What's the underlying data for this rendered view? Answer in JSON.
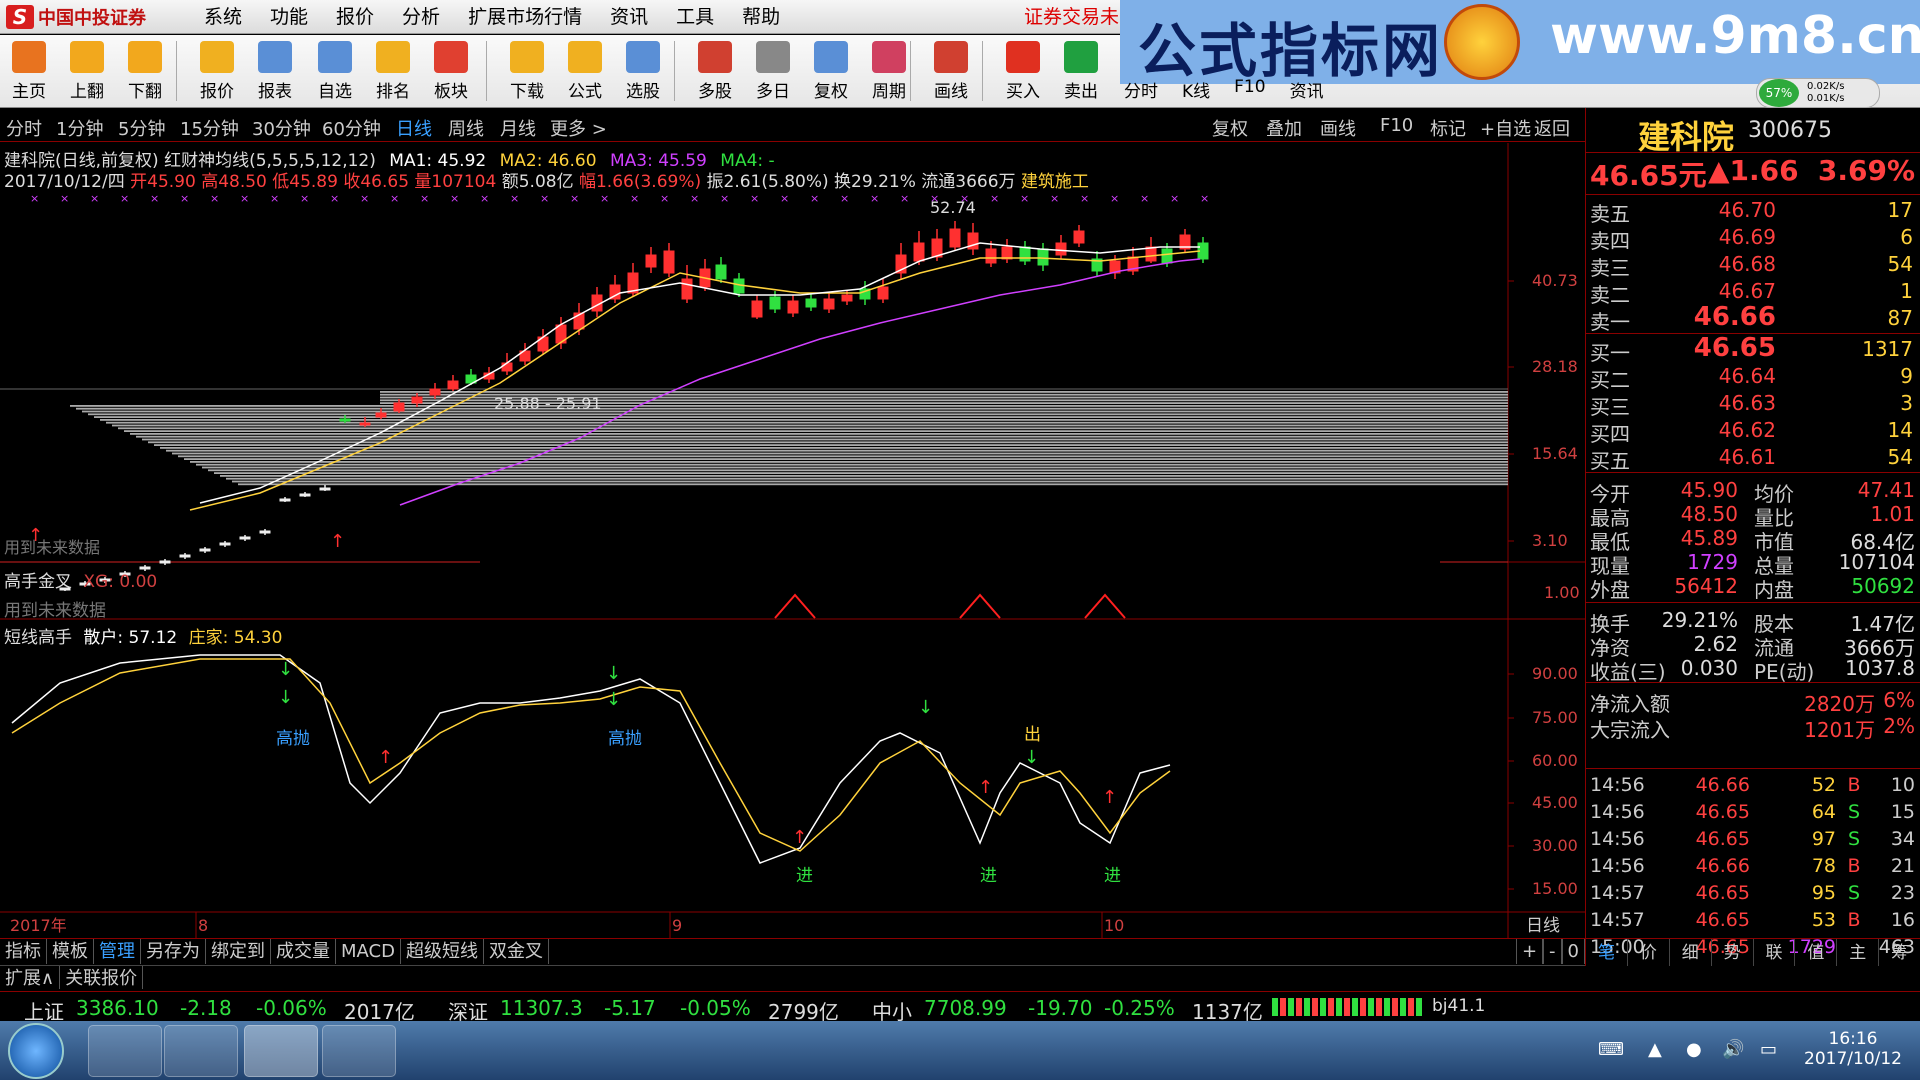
{
  "app": {
    "logo_text": "中国中投证券",
    "logo_mark": "S"
  },
  "menu": [
    "系统",
    "功能",
    "报价",
    "分析",
    "扩展市场行情",
    "资讯",
    "工具",
    "帮助"
  ],
  "menu_warning": "证券交易未",
  "toolbar": [
    {
      "label": "主页",
      "icon": "home-icon",
      "color": "#e8731f"
    },
    {
      "label": "上翻",
      "icon": "up-arrow-icon",
      "color": "#f2a81d"
    },
    {
      "label": "下翻",
      "icon": "down-arrow-icon",
      "color": "#f2a81d"
    },
    {
      "label": "报价",
      "icon": "yen-icon",
      "color": "#f0b020"
    },
    {
      "label": "报表",
      "icon": "report-icon",
      "color": "#5a8fd6"
    },
    {
      "label": "自选",
      "icon": "f6-icon",
      "color": "#5a8fd6"
    },
    {
      "label": "排名",
      "icon": "ranking-icon",
      "color": "#f0b020"
    },
    {
      "label": "板块",
      "icon": "blocks-icon",
      "color": "#e04030"
    },
    {
      "label": "下载",
      "icon": "download-icon",
      "color": "#f0b020"
    },
    {
      "label": "公式",
      "icon": "formula-icon",
      "color": "#f0b020"
    },
    {
      "label": "选股",
      "icon": "stock-pick-icon",
      "color": "#5a8fd6"
    },
    {
      "label": "多股",
      "icon": "multi-stock-icon",
      "color": "#d04030"
    },
    {
      "label": "多日",
      "icon": "clock-icon",
      "color": "#888888"
    },
    {
      "label": "复权",
      "icon": "restore-icon",
      "color": "#5a8fd6"
    },
    {
      "label": "周期",
      "icon": "f8-icon",
      "color": "#d04060"
    },
    {
      "label": "画线",
      "icon": "draw-line-icon",
      "color": "#d04030"
    },
    {
      "label": "买入",
      "icon": "buy-icon",
      "color": "#e03020"
    },
    {
      "label": "卖出",
      "icon": "sell-icon",
      "color": "#20a040"
    }
  ],
  "ad": {
    "left": "公式指标网",
    "right": "www.9m8.cn"
  },
  "ad_submenu": [
    "分时",
    "K线",
    "F10",
    "资讯"
  ],
  "net": {
    "pct": "57%",
    "up": "0.02K/s",
    "down": "0.01K/s"
  },
  "periods": [
    "分时",
    "1分钟",
    "5分钟",
    "15分钟",
    "30分钟",
    "60分钟",
    "日线",
    "周线",
    "月线",
    "更多 >"
  ],
  "active_period": "日线",
  "period_buttons": [
    "复权",
    "叠加",
    "画线",
    "F10",
    "标记",
    "+自选",
    "返回"
  ],
  "chart_header": {
    "line1_prefix": "建科院(日线,前复权) 红财神均线(5,5,5,5,12,12)",
    "ma1": "MA1: 45.92",
    "ma2": "MA2: 46.60",
    "ma3": "MA3: 45.59",
    "ma4": "MA4: -",
    "line2_date": "2017/10/12/四",
    "line2_ohlc": "开45.90 高48.50 低45.89 收46.65 量107104",
    "line2_amt": "额5.08亿",
    "line2_pct": "幅1.66(3.69%)",
    "line2_rest": "振2.61(5.80%) 换29.21% 流通3666万",
    "line2_sector": "建筑施工"
  },
  "main_annotations": {
    "high": "52.74",
    "range": "25.88 - 25.91",
    "bottom_left": "用到未来数据"
  },
  "indicator1": {
    "name": "高手金叉",
    "param": "XG: 0.00",
    "note": "用到未来数据"
  },
  "indicator2": {
    "name": "短线高手",
    "sanhu": "散户: 57.12",
    "zhuangjia": "庄家: 54.30",
    "labels": [
      "高抛",
      "高抛",
      "出",
      "进",
      "进",
      "进"
    ]
  },
  "date_axis": {
    "year": "2017年",
    "months": [
      "8",
      "9",
      "10"
    ],
    "period": "日线"
  },
  "chart_data": [
    {
      "type": "candlestick",
      "title": "建科院(日线,前复权)",
      "y_axis_labels": [
        "40.73",
        "28.18",
        "15.64",
        "3.10",
        "1.00"
      ],
      "series": [
        {
          "name": "MA1",
          "value": 45.92
        },
        {
          "name": "MA2",
          "value": 46.6
        },
        {
          "name": "MA3",
          "value": 45.59
        },
        {
          "name": "MA4",
          "value": "-"
        }
      ],
      "last_bar": {
        "open": 45.9,
        "high": 48.5,
        "low": 45.89,
        "close": 46.65,
        "volume": 107104
      }
    },
    {
      "type": "line",
      "title": "短线高手",
      "y_axis_labels": [
        "90.00",
        "75.00",
        "60.00",
        "45.00",
        "30.00",
        "15.00"
      ],
      "series": [
        {
          "name": "散户",
          "last": 57.12
        },
        {
          "name": "庄家",
          "last": 54.3
        }
      ]
    }
  ],
  "stock": {
    "name": "建科院",
    "code": "300675",
    "price": "46.65元",
    "change": "▲1.66",
    "pct": "3.69%"
  },
  "orderbook": [
    {
      "label": "卖五",
      "price": "46.70",
      "vol": "17"
    },
    {
      "label": "卖四",
      "price": "46.69",
      "vol": "6"
    },
    {
      "label": "卖三",
      "price": "46.68",
      "vol": "54"
    },
    {
      "label": "卖二",
      "price": "46.67",
      "vol": "1"
    },
    {
      "label": "卖一",
      "price": "46.66",
      "vol": "87"
    },
    {
      "label": "买一",
      "price": "46.65",
      "vol": "1317"
    },
    {
      "label": "买二",
      "price": "46.64",
      "vol": "9"
    },
    {
      "label": "买三",
      "price": "46.63",
      "vol": "3"
    },
    {
      "label": "买四",
      "price": "46.62",
      "vol": "14"
    },
    {
      "label": "买五",
      "price": "46.61",
      "vol": "54"
    }
  ],
  "stats": [
    {
      "l1": "今开",
      "v1": "45.90",
      "c1": "#ff4040",
      "l2": "均价",
      "v2": "47.41",
      "c2": "#ff4040"
    },
    {
      "l1": "最高",
      "v1": "48.50",
      "c1": "#ff4040",
      "l2": "量比",
      "v2": "1.01",
      "c2": "#ff4040"
    },
    {
      "l1": "最低",
      "v1": "45.89",
      "c1": "#ff4040",
      "l2": "市值",
      "v2": "68.4亿",
      "c2": "#dddddd"
    },
    {
      "l1": "现量",
      "v1": "1729",
      "c1": "#d040ff",
      "l2": "总量",
      "v2": "107104",
      "c2": "#dddddd"
    },
    {
      "l1": "外盘",
      "v1": "56412",
      "c1": "#ff4040",
      "l2": "内盘",
      "v2": "50692",
      "c2": "#30e040"
    }
  ],
  "stats2": [
    {
      "l1": "换手",
      "v1": "29.21%",
      "l2": "股本",
      "v2": "1.47亿"
    },
    {
      "l1": "净资",
      "v1": "2.62",
      "l2": "流通",
      "v2": "3666万"
    },
    {
      "l1": "收益(三)",
      "v1": "0.030",
      "l2": "PE(动)",
      "v2": "1037.8"
    }
  ],
  "flows": [
    {
      "label": "净流入额",
      "value": "2820万",
      "pct": "6%"
    },
    {
      "label": "大宗流入",
      "value": "1201万",
      "pct": "2%"
    }
  ],
  "ticks": [
    {
      "t": "14:56",
      "p": "46.66",
      "v": "52",
      "s": "B",
      "c": "10"
    },
    {
      "t": "14:56",
      "p": "46.65",
      "v": "64",
      "s": "S",
      "c": "15"
    },
    {
      "t": "14:56",
      "p": "46.65",
      "v": "97",
      "s": "S",
      "c": "34"
    },
    {
      "t": "14:56",
      "p": "46.66",
      "v": "78",
      "s": "B",
      "c": "21"
    },
    {
      "t": "14:57",
      "p": "46.65",
      "v": "95",
      "s": "S",
      "c": "23"
    },
    {
      "t": "14:57",
      "p": "46.65",
      "v": "53",
      "s": "B",
      "c": "16"
    },
    {
      "t": "15:00",
      "p": "46.65",
      "v": "1729",
      "s": "",
      "c": "463"
    }
  ],
  "rp_tabs": [
    "笔",
    "价",
    "细",
    "势",
    "联",
    "值",
    "主",
    "筹"
  ],
  "bottom_tabs": [
    "指标",
    "模板",
    "管理",
    "另存为",
    "绑定到",
    "成交量",
    "MACD",
    "超级短线",
    "双金叉"
  ],
  "bottom_tabs_active": "管理",
  "bottom_tabs2": [
    "扩展∧",
    "关联报价"
  ],
  "bottom_right_btns": [
    "+",
    "-",
    "0"
  ],
  "ticker": [
    {
      "name": "上证",
      "idx": "3386.10",
      "chg": "-2.18",
      "pct": "-0.06%",
      "amt": "2017亿"
    },
    {
      "name": "深证",
      "idx": "11307.3",
      "chg": "-5.17",
      "pct": "-0.05%",
      "amt": "2799亿"
    },
    {
      "name": "中小",
      "idx": "7708.99",
      "chg": "-19.70",
      "pct": "-0.25%",
      "amt": "1137亿"
    }
  ],
  "ticker_server": "bj41.1",
  "clock": {
    "time": "16:16",
    "date": "2017/10/12"
  }
}
